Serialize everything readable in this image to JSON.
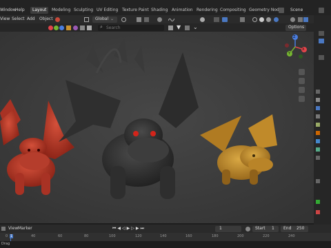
{
  "menus": [
    "Window",
    "Help"
  ],
  "workspaces": [
    "Layout",
    "Modeling",
    "Sculpting",
    "UV Editing",
    "Texture Paint",
    "Shading",
    "Animation",
    "Rendering",
    "Compositing",
    "Geometry Node"
  ],
  "active_workspace": "Layout",
  "scene_name": "Scene",
  "header": {
    "view": "View",
    "select": "Select",
    "add": "Add",
    "object": "Object",
    "orientation": "Global",
    "options": "Options"
  },
  "search_placeholder": "Search",
  "timeline": {
    "view": "View",
    "marker": "Marker",
    "current_frame": "1",
    "start_label": "Start",
    "start_value": "1",
    "end_label": "End",
    "end_value": "250"
  },
  "ruler_ticks": [
    "0",
    "40",
    "60",
    "80",
    "100",
    "120",
    "140",
    "160",
    "180",
    "200",
    "220",
    "240"
  ],
  "status_text": "Drag",
  "gizmo": {
    "x": "X",
    "y": "Y",
    "z": "Z"
  },
  "colors": {
    "accent": "#4a78c2",
    "x_axis": "#e2444a",
    "y_axis": "#76b531",
    "z_axis": "#4a7ddf",
    "dragon_red": "#c0392b",
    "dragon_dark": "#3a3a3a",
    "dragon_gold": "#c9912e"
  }
}
